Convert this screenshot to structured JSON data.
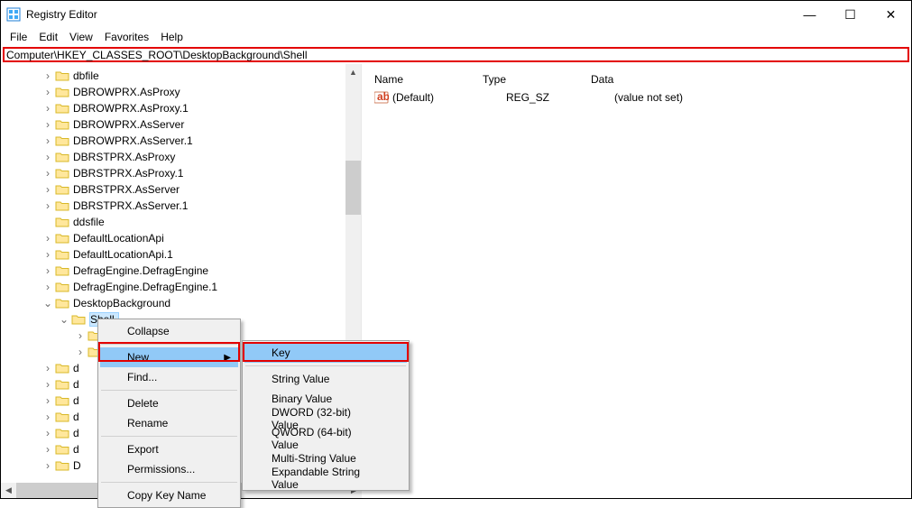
{
  "window": {
    "title": "Registry Editor"
  },
  "controls": {
    "min": "—",
    "max": "☐",
    "close": "✕"
  },
  "menu": {
    "file": "File",
    "edit": "Edit",
    "view": "View",
    "favorites": "Favorites",
    "help": "Help"
  },
  "address": "Computer\\HKEY_CLASSES_ROOT\\DesktopBackground\\Shell",
  "tree": {
    "items": [
      {
        "indent": 2,
        "exp": ">",
        "label": "dbfile"
      },
      {
        "indent": 2,
        "exp": ">",
        "label": "DBROWPRX.AsProxy"
      },
      {
        "indent": 2,
        "exp": ">",
        "label": "DBROWPRX.AsProxy.1"
      },
      {
        "indent": 2,
        "exp": ">",
        "label": "DBROWPRX.AsServer"
      },
      {
        "indent": 2,
        "exp": ">",
        "label": "DBROWPRX.AsServer.1"
      },
      {
        "indent": 2,
        "exp": ">",
        "label": "DBRSTPRX.AsProxy"
      },
      {
        "indent": 2,
        "exp": ">",
        "label": "DBRSTPRX.AsProxy.1"
      },
      {
        "indent": 2,
        "exp": ">",
        "label": "DBRSTPRX.AsServer"
      },
      {
        "indent": 2,
        "exp": ">",
        "label": "DBRSTPRX.AsServer.1"
      },
      {
        "indent": 2,
        "exp": "",
        "label": "ddsfile"
      },
      {
        "indent": 2,
        "exp": ">",
        "label": "DefaultLocationApi"
      },
      {
        "indent": 2,
        "exp": ">",
        "label": "DefaultLocationApi.1"
      },
      {
        "indent": 2,
        "exp": ">",
        "label": "DefragEngine.DefragEngine"
      },
      {
        "indent": 2,
        "exp": ">",
        "label": "DefragEngine.DefragEngine.1"
      },
      {
        "indent": 2,
        "exp": "v",
        "label": "DesktopBackground"
      }
    ],
    "selected_sub": "Shell",
    "obscured": [
      {
        "indent": 4,
        "exp": ">",
        "fragment": ""
      },
      {
        "indent": 4,
        "exp": ">",
        "fragment": ""
      },
      {
        "indent": 2,
        "exp": ">",
        "fragment": "d"
      },
      {
        "indent": 2,
        "exp": ">",
        "fragment": "d"
      },
      {
        "indent": 2,
        "exp": ">",
        "fragment": "d"
      },
      {
        "indent": 2,
        "exp": ">",
        "fragment": "d"
      },
      {
        "indent": 2,
        "exp": ">",
        "fragment": "d"
      },
      {
        "indent": 2,
        "exp": ">",
        "fragment": "d"
      },
      {
        "indent": 2,
        "exp": ">",
        "fragment": "D"
      }
    ]
  },
  "list": {
    "cols": {
      "name": "Name",
      "type": "Type",
      "data": "Data"
    },
    "rows": [
      {
        "name": "(Default)",
        "type": "REG_SZ",
        "data": "(value not set)"
      }
    ]
  },
  "context1": {
    "collapse": "Collapse",
    "new": "New",
    "find": "Find...",
    "delete": "Delete",
    "rename": "Rename",
    "export": "Export",
    "permissions": "Permissions...",
    "copy": "Copy Key Name"
  },
  "context2": {
    "key": "Key",
    "string": "String Value",
    "binary": "Binary Value",
    "dword": "DWORD (32-bit) Value",
    "qword": "QWORD (64-bit) Value",
    "multi": "Multi-String Value",
    "exp": "Expandable String Value"
  }
}
